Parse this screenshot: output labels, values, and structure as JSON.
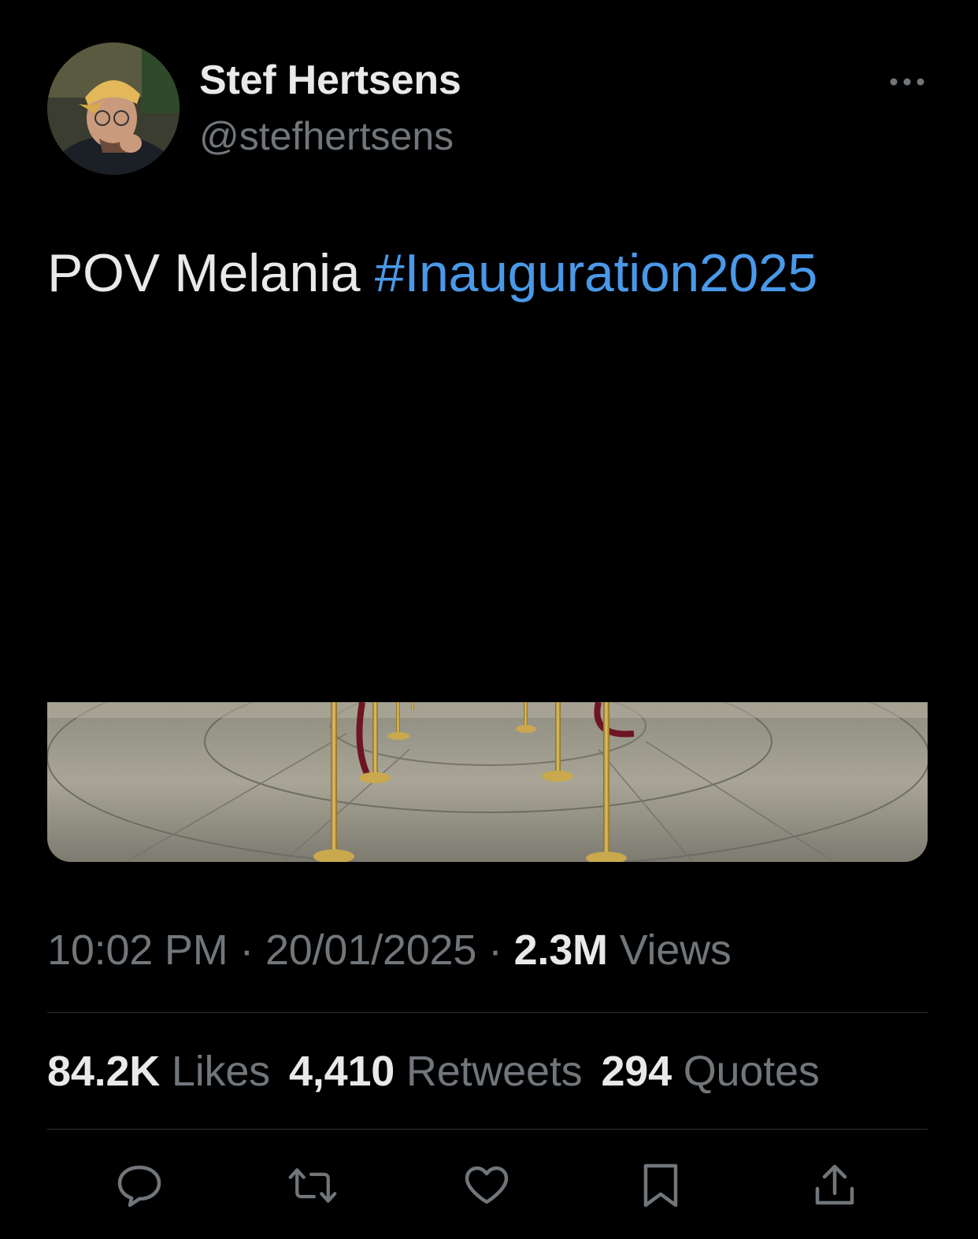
{
  "author": {
    "display_name": "Stef Hertsens",
    "handle": "@stefhertsens"
  },
  "tweet": {
    "text": "POV Melania ",
    "hashtag": "#Inauguration2025"
  },
  "meta": {
    "time": "10:02 PM",
    "separator_1": " · ",
    "date": "20/01/2025",
    "separator_2": " · ",
    "views_count": "2.3M",
    "views_label": " Views"
  },
  "stats": {
    "likes_count": "84.2K",
    "likes_label": " Likes",
    "retweets_count": "4,410",
    "retweets_label": " Retweets",
    "quotes_count": "294",
    "quotes_label": " Quotes"
  },
  "colors": {
    "background": "#000000",
    "text_primary": "#e7e9ea",
    "text_secondary": "#71767b",
    "link": "#4a99e9",
    "divider": "#2f3336"
  },
  "icons": {
    "more": "more-dots-icon",
    "reply": "reply-bubble-icon",
    "retweet": "retweet-icon",
    "like": "heart-icon",
    "bookmark": "bookmark-icon",
    "share": "share-upload-icon"
  }
}
